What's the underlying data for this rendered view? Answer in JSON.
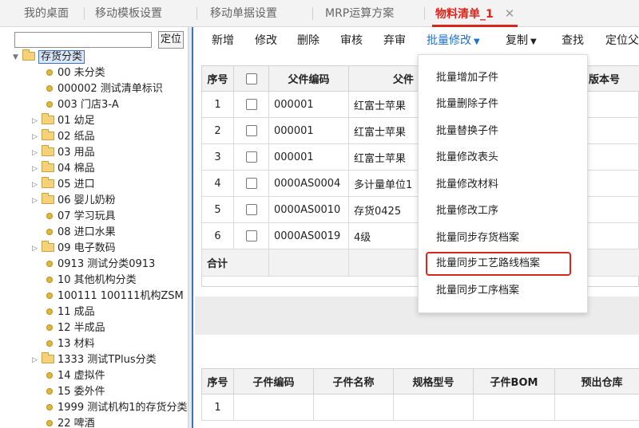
{
  "tabs": [
    {
      "label": "我的桌面"
    },
    {
      "label": "移动模板设置"
    },
    {
      "label": "移动单据设置"
    },
    {
      "label": "MRP运算方案"
    },
    {
      "label": "物料清单_1",
      "close": "✕"
    }
  ],
  "left": {
    "search_value": "",
    "locate_label": "定位",
    "tree": [
      {
        "label": "存货分类",
        "type": "root"
      },
      {
        "label": "00 未分类",
        "type": "leaf"
      },
      {
        "label": "000002 测试清单标识",
        "type": "leaf"
      },
      {
        "label": "003 门店3-A",
        "type": "leaf"
      },
      {
        "label": "01 幼足",
        "type": "folder"
      },
      {
        "label": "02 纸品",
        "type": "folder"
      },
      {
        "label": "03 用品",
        "type": "folder"
      },
      {
        "label": "04 棉品",
        "type": "folder"
      },
      {
        "label": "05 进口",
        "type": "folder"
      },
      {
        "label": "06 婴儿奶粉",
        "type": "folder"
      },
      {
        "label": "07 学习玩具",
        "type": "leaf"
      },
      {
        "label": "08 进口水果",
        "type": "leaf"
      },
      {
        "label": "09 电子数码",
        "type": "folder"
      },
      {
        "label": "0913 测试分类0913",
        "type": "leaf"
      },
      {
        "label": "10 其他机构分类",
        "type": "leaf"
      },
      {
        "label": "100111 100111机构ZSM",
        "type": "leaf"
      },
      {
        "label": "11 成品",
        "type": "leaf"
      },
      {
        "label": "12 半成品",
        "type": "leaf"
      },
      {
        "label": "13 材料",
        "type": "leaf"
      },
      {
        "label": "1333 测试TPlus分类",
        "type": "folder"
      },
      {
        "label": "14 虚拟件",
        "type": "leaf"
      },
      {
        "label": "15 委外件",
        "type": "leaf"
      },
      {
        "label": "1999 测试机构1的存货分类",
        "type": "leaf"
      },
      {
        "label": "22 啤酒",
        "type": "leaf"
      }
    ]
  },
  "toolbar": {
    "add": "新增",
    "edit": "修改",
    "delete": "删除",
    "audit": "审核",
    "abandon": "弃审",
    "batch_edit": "批量修改",
    "copy": "复制",
    "find": "查找",
    "locate_parent": "定位父"
  },
  "parent_grid": {
    "headers": [
      "序号",
      "",
      "父件编码",
      "父件",
      "版本号"
    ],
    "rows": [
      {
        "no": "1",
        "code": "000001",
        "name": "红富士苹果"
      },
      {
        "no": "2",
        "code": "000001",
        "name": "红富士苹果"
      },
      {
        "no": "3",
        "code": "000001",
        "name": "红富士苹果"
      },
      {
        "no": "4",
        "code": "0000AS0004",
        "name": "多计量单位1"
      },
      {
        "no": "5",
        "code": "0000AS0010",
        "name": "存货0425"
      },
      {
        "no": "6",
        "code": "0000AS0019",
        "name": "4级"
      }
    ],
    "total_label": "合计"
  },
  "batch_menu": {
    "items": [
      "批量增加子件",
      "批量删除子件",
      "批量替换子件",
      "批量修改表头",
      "批量修改材料",
      "批量修改工序",
      "批量同步存货档案",
      "批量同步工艺路线档案",
      "批量同步工序档案"
    ],
    "highlighted_index": 7,
    "highlight_color": "#d9261c"
  },
  "child_grid": {
    "headers": [
      "序号",
      "子件编码",
      "子件名称",
      "规格型号",
      "子件BOM",
      "预出仓库"
    ],
    "rows": [
      {
        "no": "1"
      }
    ]
  },
  "colors": {
    "accent": "#1f6fd1",
    "active_tab": "#d9261c"
  }
}
